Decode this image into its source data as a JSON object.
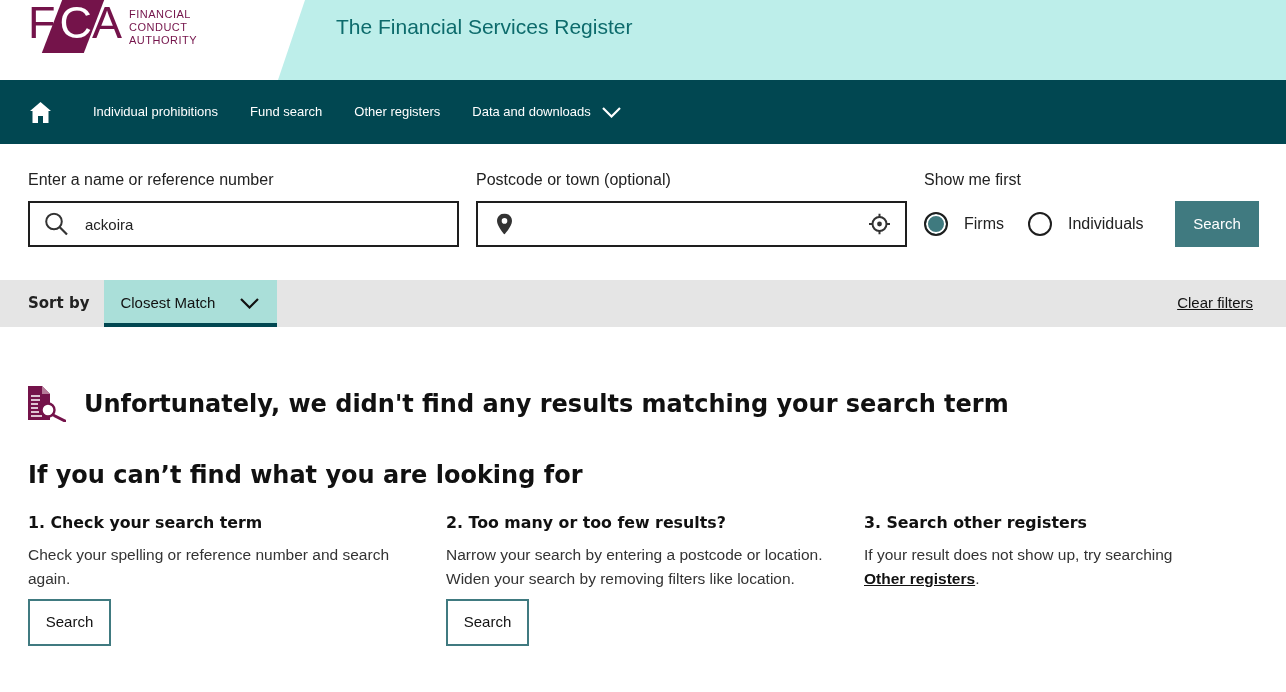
{
  "header": {
    "logo": {
      "letters": [
        "F",
        "C",
        "A"
      ],
      "lines": [
        "FINANCIAL",
        "CONDUCT",
        "AUTHORITY"
      ]
    },
    "title": "The Financial Services Register"
  },
  "nav": {
    "items": [
      {
        "kind": "home"
      },
      {
        "kind": "link",
        "label": "Individual prohibitions"
      },
      {
        "kind": "link",
        "label": "Fund search"
      },
      {
        "kind": "link",
        "label": "Other registers"
      },
      {
        "kind": "menu",
        "label": "Data and downloads"
      }
    ]
  },
  "search": {
    "name_field": {
      "label": "Enter a name or reference number",
      "value": "ackoira"
    },
    "location_field": {
      "label": "Postcode or town (optional)"
    },
    "show_first": {
      "label": "Show me first",
      "options": [
        {
          "label": "Firms",
          "selected": true
        },
        {
          "label": "Individuals",
          "selected": false
        }
      ]
    },
    "button": "Search"
  },
  "sort_bar": {
    "label": "Sort by",
    "value": "Closest Match",
    "clear": "Clear filters"
  },
  "no_results": {
    "message": "Unfortunately, we didn't find any results matching your search term"
  },
  "help": {
    "title": "If you can’t find what you are looking for",
    "steps": [
      {
        "title": "1. Check your search term",
        "text": "Check your spelling or reference number and search again.",
        "button": "Search"
      },
      {
        "title": "2. Too many or too few results?",
        "text": "Narrow your search by entering a postcode or location. Widen your search by removing filters like location.",
        "button": "Search"
      },
      {
        "title": "3. Search other registers",
        "text": "If your result does not show up, try searching",
        "link": "Other registers",
        "text_after": "."
      }
    ]
  }
}
